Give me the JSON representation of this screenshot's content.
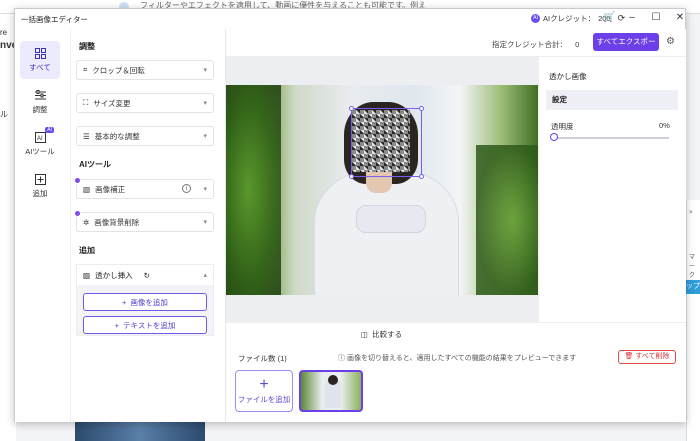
{
  "background": {
    "top_text": "フィルターやエフェクトを適用して、動画に優性を与えることも可能です。例え",
    "left_labels": [
      "re",
      "nve",
      "ル"
    ],
    "right_labels": [
      "×",
      "マーク",
      "ップ"
    ]
  },
  "window": {
    "app_title": "一括画像エディター",
    "credit_label": "AIクレジット：",
    "credit_value": "200",
    "ai_chip": "AI"
  },
  "nav": {
    "items": [
      {
        "label": "すべて",
        "icon": "grid-icon"
      },
      {
        "label": "調整",
        "icon": "sliders-icon"
      },
      {
        "label": "AIツール",
        "icon": "ai-icon",
        "badge": "AI"
      },
      {
        "label": "追加",
        "icon": "plus-square-icon"
      }
    ]
  },
  "tools": {
    "adjust_title": "調整",
    "crop": "クロップ＆回転",
    "resize": "サイズ変更",
    "basic": "基本的な調整",
    "ai_title": "AIツール",
    "enhance": "画像補正",
    "bg_remove": "画像背景削除",
    "add_title": "追加",
    "watermark": "透かし挿入",
    "add_image": "画像を追加",
    "add_text": "テキストを追加"
  },
  "toolbar": {
    "selected_credit_label": "指定クレジット合計：",
    "selected_credit_value": "0",
    "export": "すべてエクスポート"
  },
  "right_panel": {
    "title": "透かし画像",
    "settings": "設定",
    "opacity_label": "透明度",
    "opacity_value": "0%",
    "opacity": 0.0
  },
  "bottom": {
    "compare": "比較する",
    "file_count": "ファイル数 (1)",
    "hint": "画像を切り替えると、適用したすべての機能の結果をプレビューできます",
    "delete_all": "すべて削除",
    "add_file": "ファイルを追加"
  },
  "colors": {
    "accent": "#6c3fe8",
    "danger": "#e04a4a"
  }
}
